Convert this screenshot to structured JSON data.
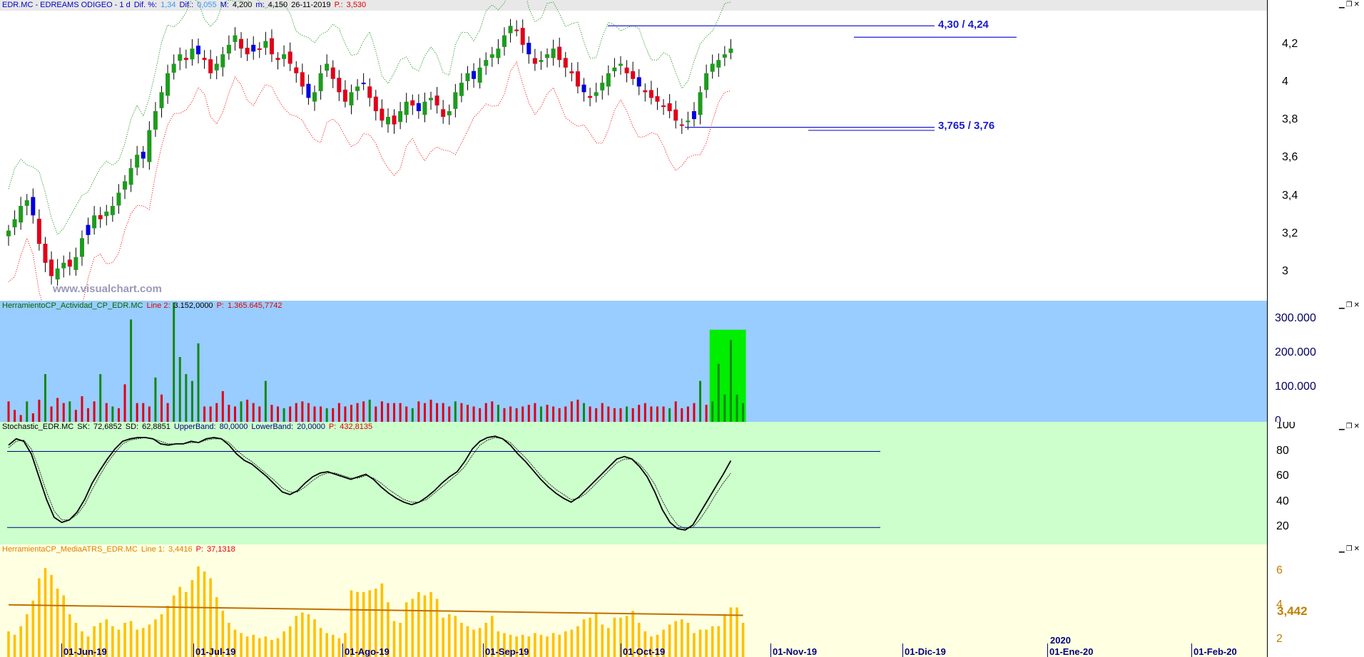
{
  "panel_price": {
    "title": {
      "symbol": "EDR.MC - EDREAMS ODIGEO -  1 d",
      "dif_pct_label": "Dif. %:",
      "dif_pct": "1,34",
      "dif_label": "Dif.:",
      "dif": "0,055",
      "max_label": "M:",
      "max": "4,200",
      "min_label": "m:",
      "min": "4,150",
      "date": "26-11-2019",
      "p_label": "P.:",
      "p": "3,530"
    },
    "watermark": "www.visualchart.com",
    "level_high": "4,30 / 4,24",
    "level_low": "3,765 / 3,76",
    "yticks": [
      "4,2",
      "4",
      "3,8",
      "3,6",
      "3,4",
      "3,2",
      "3"
    ]
  },
  "panel_volume": {
    "title": {
      "name": "HerramientoCP_Actividad_CP_EDR.MC",
      "line2_label": "Line 2:",
      "line2": "3.152,0000",
      "p_label": "P:",
      "p": "1.365.645,7742"
    },
    "yticks": [
      "300.000",
      "200.000",
      "100.000",
      "0"
    ]
  },
  "panel_stoch": {
    "title": {
      "name": "Stochastic_EDR.MC",
      "sk_label": "SK:",
      "sk": "72,6852",
      "sd_label": "SD:",
      "sd": "62,8851",
      "ub_label": "UpperBand:",
      "ub": "80,0000",
      "lb_label": "LowerBand:",
      "lb": "20,0000",
      "p_label": "P:",
      "p": "432,8135"
    },
    "yticks": [
      "100",
      "80",
      "60",
      "40",
      "20"
    ]
  },
  "panel_atr": {
    "title": {
      "name": "HerramientaCP_MediaATRS_EDR.MC",
      "line1_label": "Line 1:",
      "line1": "3,4416",
      "p_label": "P:",
      "p": "37,1318"
    },
    "yticks": [
      "6",
      "4",
      "2"
    ],
    "last_value": "3,442"
  },
  "xaxis": {
    "labels": [
      "01-Jun-19",
      "01-Jul-19",
      "01-Ago-19",
      "01-Sep-19",
      "01-Oct-19",
      "01-Nov-19",
      "01-Dic-19",
      "01-Ene-20",
      "01-Feb-20"
    ],
    "year_label": "2020"
  },
  "colors": {
    "up": "#1e9b1e",
    "down": "#e0001a",
    "neutral": "#0000e0",
    "band_high": "#008800",
    "band_low": "#ee0000",
    "volume_bg": "#99ccff",
    "stoch_bg": "#ccffcc",
    "atr_bg": "#ffffe1",
    "highlight": "#00ee00"
  },
  "chart_data": [
    {
      "type": "candlestick",
      "title": "EDR.MC - EDREAMS ODIGEO - 1 d",
      "x_range": [
        "2019-05-13",
        "2019-11-26"
      ],
      "ylim": [
        2.85,
        4.38
      ],
      "close": [
        3.22,
        3.28,
        3.35,
        3.38,
        3.3,
        3.15,
        3.05,
        2.98,
        3.02,
        3.05,
        3.03,
        3.08,
        3.18,
        3.25,
        3.3,
        3.28,
        3.32,
        3.35,
        3.42,
        3.48,
        3.55,
        3.62,
        3.6,
        3.75,
        3.85,
        3.95,
        4.05,
        4.1,
        4.15,
        4.12,
        4.18,
        4.15,
        4.12,
        4.05,
        4.1,
        4.15,
        4.2,
        4.25,
        4.18,
        4.15,
        4.2,
        4.18,
        4.22,
        4.15,
        4.12,
        4.15,
        4.1,
        4.05,
        3.98,
        3.92,
        3.95,
        4.05,
        4.1,
        4.02,
        3.95,
        3.9,
        3.95,
        3.98,
        4.0,
        3.92,
        3.85,
        3.8,
        3.82,
        3.78,
        3.85,
        3.9,
        3.88,
        3.85,
        3.9,
        3.92,
        3.88,
        3.82,
        3.85,
        3.95,
        4.0,
        4.05,
        4.02,
        4.08,
        4.12,
        4.15,
        4.18,
        4.25,
        4.3,
        4.28,
        4.2,
        4.15,
        4.1,
        4.12,
        4.15,
        4.18,
        4.12,
        4.08,
        4.05,
        3.98,
        3.95,
        3.92,
        3.95,
        4.0,
        4.05,
        4.08,
        4.1,
        4.05,
        4.02,
        3.98,
        3.95,
        3.92,
        3.9,
        3.88,
        3.85,
        3.8,
        3.78,
        3.8,
        3.85,
        3.95,
        4.05,
        4.1,
        4.12,
        4.15,
        4.18
      ],
      "band_upper_approx_max": 4.4,
      "band_lower_approx_min": 2.9,
      "levels": [
        {
          "label": "4,30 / 4,24",
          "value": 4.3
        },
        {
          "value": 4.24
        },
        {
          "label": "3,765 / 3,76",
          "value": 3.765
        },
        {
          "value": 3.76
        }
      ]
    },
    {
      "type": "bar",
      "title": "HerramientoCP_Actividad_CP_EDR.MC",
      "ylim": [
        0,
        330000
      ],
      "values": [
        60000,
        35000,
        20000,
        60000,
        25000,
        65000,
        140000,
        45000,
        70000,
        55000,
        60000,
        35000,
        75000,
        40000,
        60000,
        140000,
        55000,
        45000,
        40000,
        110000,
        300000,
        55000,
        55000,
        45000,
        130000,
        80000,
        55000,
        350000,
        190000,
        140000,
        120000,
        230000,
        45000,
        45000,
        55000,
        90000,
        50000,
        45000,
        60000,
        65000,
        55000,
        45000,
        120000,
        50000,
        45000,
        40000,
        45000,
        55000,
        60000,
        55000,
        45000,
        45000,
        40000,
        40000,
        55000,
        45000,
        50000,
        55000,
        60000,
        65000,
        45000,
        60000,
        55000,
        55000,
        55000,
        45000,
        40000,
        60000,
        55000,
        65000,
        55000,
        55000,
        45000,
        60000,
        55000,
        50000,
        45000,
        40000,
        55000,
        60000,
        50000,
        40000,
        45000,
        40000,
        45000,
        50000,
        55000,
        45000,
        50000,
        45000,
        40000,
        45000,
        60000,
        65000,
        55000,
        45000,
        40000,
        55000,
        45000,
        40000,
        40000,
        45000,
        40000,
        50000,
        55000,
        45000,
        45000,
        45000,
        40000,
        60000,
        40000,
        45000,
        55000,
        120000,
        50000,
        60000,
        170000,
        80000,
        240000,
        80000,
        55000
      ],
      "highlight_range": "last 6 bars (green box)"
    },
    {
      "type": "line",
      "title": "Stochastic_EDR.MC",
      "ylim": [
        10,
        100
      ],
      "upper_band": 80,
      "lower_band": 20,
      "series": [
        {
          "name": "SK",
          "values": [
            85,
            90,
            88,
            78,
            60,
            42,
            28,
            24,
            26,
            32,
            42,
            55,
            65,
            74,
            82,
            88,
            90,
            91,
            91,
            90,
            86,
            85,
            86,
            86,
            88,
            87,
            90,
            91,
            90,
            85,
            78,
            73,
            70,
            65,
            60,
            54,
            48,
            46,
            49,
            55,
            60,
            63,
            64,
            62,
            60,
            58,
            60,
            62,
            58,
            52,
            47,
            43,
            40,
            38,
            40,
            44,
            49,
            55,
            60,
            64,
            72,
            82,
            88,
            91,
            92,
            90,
            85,
            78,
            72,
            65,
            58,
            52,
            47,
            43,
            40,
            44,
            50,
            56,
            62,
            68,
            74,
            76,
            74,
            68,
            60,
            48,
            34,
            24,
            19,
            18,
            22,
            32,
            42,
            52,
            62,
            72.7
          ]
        },
        {
          "name": "SD",
          "values": [
            83,
            88,
            89,
            82,
            66,
            48,
            33,
            26,
            26,
            30,
            38,
            50,
            61,
            71,
            79,
            86,
            89,
            90,
            91,
            90,
            88,
            86,
            86,
            86,
            87,
            87,
            89,
            90,
            90,
            87,
            81,
            76,
            72,
            67,
            62,
            57,
            51,
            48,
            48,
            52,
            57,
            61,
            63,
            63,
            61,
            59,
            59,
            61,
            59,
            55,
            50,
            46,
            42,
            40,
            40,
            42,
            47,
            52,
            57,
            62,
            68,
            77,
            85,
            89,
            91,
            90,
            87,
            81,
            75,
            68,
            61,
            55,
            50,
            46,
            42,
            43,
            47,
            53,
            59,
            65,
            71,
            74,
            74,
            70,
            63,
            54,
            41,
            30,
            22,
            19,
            20,
            27,
            36,
            46,
            55,
            62.9
          ]
        }
      ]
    },
    {
      "type": "bar",
      "title": "HerramientaCP_MediaATRS_EDR.MC",
      "ylim": [
        1,
        7
      ],
      "values": [
        2.5,
        2.3,
        2.8,
        3.5,
        4.3,
        5.6,
        6.2,
        5.8,
        5.0,
        4.6,
        3.5,
        3.0,
        2.5,
        2.2,
        2.8,
        3.0,
        3.2,
        2.8,
        2.6,
        3.0,
        3.1,
        2.6,
        2.7,
        2.9,
        3.2,
        3.5,
        4.0,
        4.6,
        5.1,
        4.8,
        5.5,
        6.3,
        6.0,
        5.6,
        4.5,
        3.7,
        3.0,
        2.6,
        2.4,
        2.2,
        2.3,
        2.1,
        2.2,
        2.0,
        2.1,
        2.5,
        2.8,
        3.4,
        3.6,
        3.5,
        3.2,
        2.7,
        2.4,
        2.3,
        2.1,
        2.4,
        4.9,
        4.8,
        4.8,
        4.9,
        5.0,
        5.3,
        4.2,
        3.1,
        3.0,
        4.2,
        4.4,
        4.8,
        4.6,
        4.8,
        4.4,
        3.3,
        3.5,
        3.4,
        3.0,
        2.8,
        2.6,
        2.7,
        3.0,
        3.4,
        2.5,
        2.4,
        2.3,
        2.2,
        2.3,
        2.2,
        2.4,
        2.3,
        2.2,
        2.4,
        2.3,
        2.5,
        2.6,
        2.8,
        3.2,
        3.3,
        3.6,
        2.9,
        2.7,
        3.3,
        3.3,
        3.4,
        3.7,
        3.0,
        2.5,
        2.2,
        2.3,
        2.6,
        2.9,
        3.1,
        3.2,
        3.0,
        2.4,
        2.6,
        2.6,
        2.8,
        2.8,
        3.5,
        3.9,
        3.9,
        3.0
      ],
      "series_line": {
        "name": "Line 1",
        "start": 4.05,
        "end": 3.44
      }
    }
  ]
}
